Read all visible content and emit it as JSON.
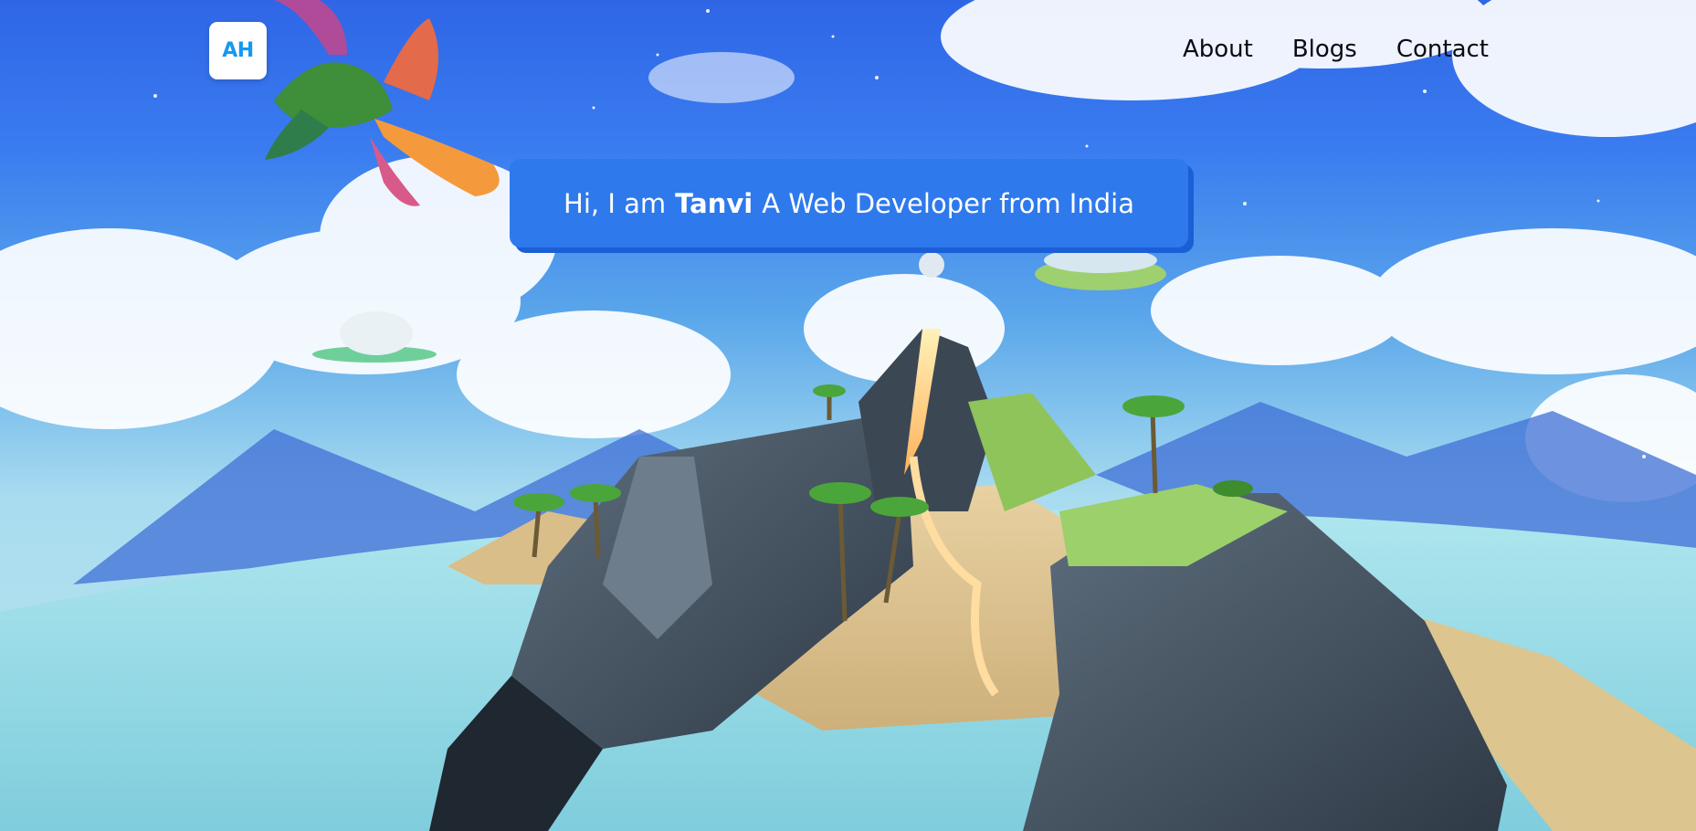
{
  "header": {
    "logo_text": "AH",
    "nav": [
      {
        "label": "About"
      },
      {
        "label": "Blogs"
      },
      {
        "label": "Contact"
      }
    ]
  },
  "hero": {
    "greeting_prefix": "Hi, I am",
    "name": "Tanvi",
    "greeting_suffix": "A Web Developer from India"
  },
  "scene": {
    "elements": [
      "sky",
      "clouds",
      "mountains",
      "sea",
      "volcanic-island",
      "palm-trees",
      "phoenix-bird",
      "floating-islands"
    ]
  }
}
